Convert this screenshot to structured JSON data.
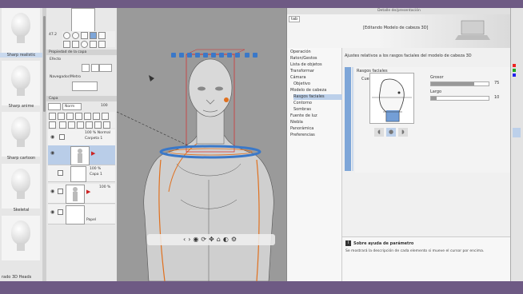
{
  "thumbnails": [
    {
      "label": "Sharp realistic",
      "selected": true
    },
    {
      "label": "Sharp anime",
      "selected": false
    },
    {
      "label": "Sharp cartoon",
      "selected": false
    },
    {
      "label": "Skeletal",
      "selected": false
    },
    {
      "label": ""
    }
  ],
  "status_text": "rado 3D Heads",
  "properties": {
    "zoom": "47.2",
    "header": "Propiedad de la capa",
    "effect_label": "Efecto",
    "nav_label": "Navegador/Metro"
  },
  "layers": {
    "header": "Capa",
    "blend": "Norm",
    "opacity": "100",
    "items": [
      {
        "name": "100 % Normal",
        "sub": "Carpeta 1",
        "kind": "folder"
      },
      {
        "name": "",
        "sub": "",
        "kind": "figure",
        "active": true
      },
      {
        "name": "100 %",
        "sub": "Capa 1",
        "kind": "blank"
      },
      {
        "name": "100 %",
        "sub": "",
        "kind": "figure2"
      },
      {
        "name": "Papel",
        "sub": "",
        "kind": "paper"
      }
    ]
  },
  "canvas": {
    "toolbar_icons": [
      "chevron-left-icon",
      "chevron-right-icon",
      "camera-icon",
      "rotate-icon",
      "move-icon",
      "pose-icon",
      "ground-icon",
      "reset-icon",
      "gear-icon"
    ]
  },
  "settings": {
    "window_title": "Detalle de/presentación",
    "tag": "tab",
    "header_title": "[Editando Modelo de cabeza 3D]",
    "nav": [
      {
        "label": "Operación",
        "sub": false
      },
      {
        "label": "Raton/Gestos",
        "sub": false
      },
      {
        "label": "Lista de objetos",
        "sub": false
      },
      {
        "label": "Transformar",
        "sub": false
      },
      {
        "label": "Cámara",
        "sub": false
      },
      {
        "label": "Objetivo",
        "sub": true
      },
      {
        "label": "Modelo de cabeza",
        "sub": false
      },
      {
        "label": "Rasgos faciales",
        "sub": true,
        "selected": true
      },
      {
        "label": "Contorno",
        "sub": true
      },
      {
        "label": "Sombras",
        "sub": true
      },
      {
        "label": "Fuente de luz",
        "sub": false
      },
      {
        "label": "Niebla",
        "sub": false
      },
      {
        "label": "Panorámica",
        "sub": false
      },
      {
        "label": "Preferencias",
        "sub": false
      }
    ],
    "description": "Ajustes relativos a los rasgos faciales del modelo de cabeza 3D",
    "section": "Rasgos faciales",
    "part": "Cuello",
    "grosor_label": "Grosor",
    "grosor_value": "75",
    "grosor_fraction": 0.75,
    "largo_label": "Largo",
    "largo_value": "10",
    "largo_fraction": 0.1,
    "help_title": "Sobre ayuda de parámetro",
    "help_desc": "Se mostrará la descripción de cada elemento si mueve el cursor por encima."
  },
  "colors": {
    "accent": "#7ea6d8",
    "frame": "#6e5a84",
    "ring": "#3a78c8",
    "bbox": "#d62828",
    "orange": "#e0701e"
  }
}
